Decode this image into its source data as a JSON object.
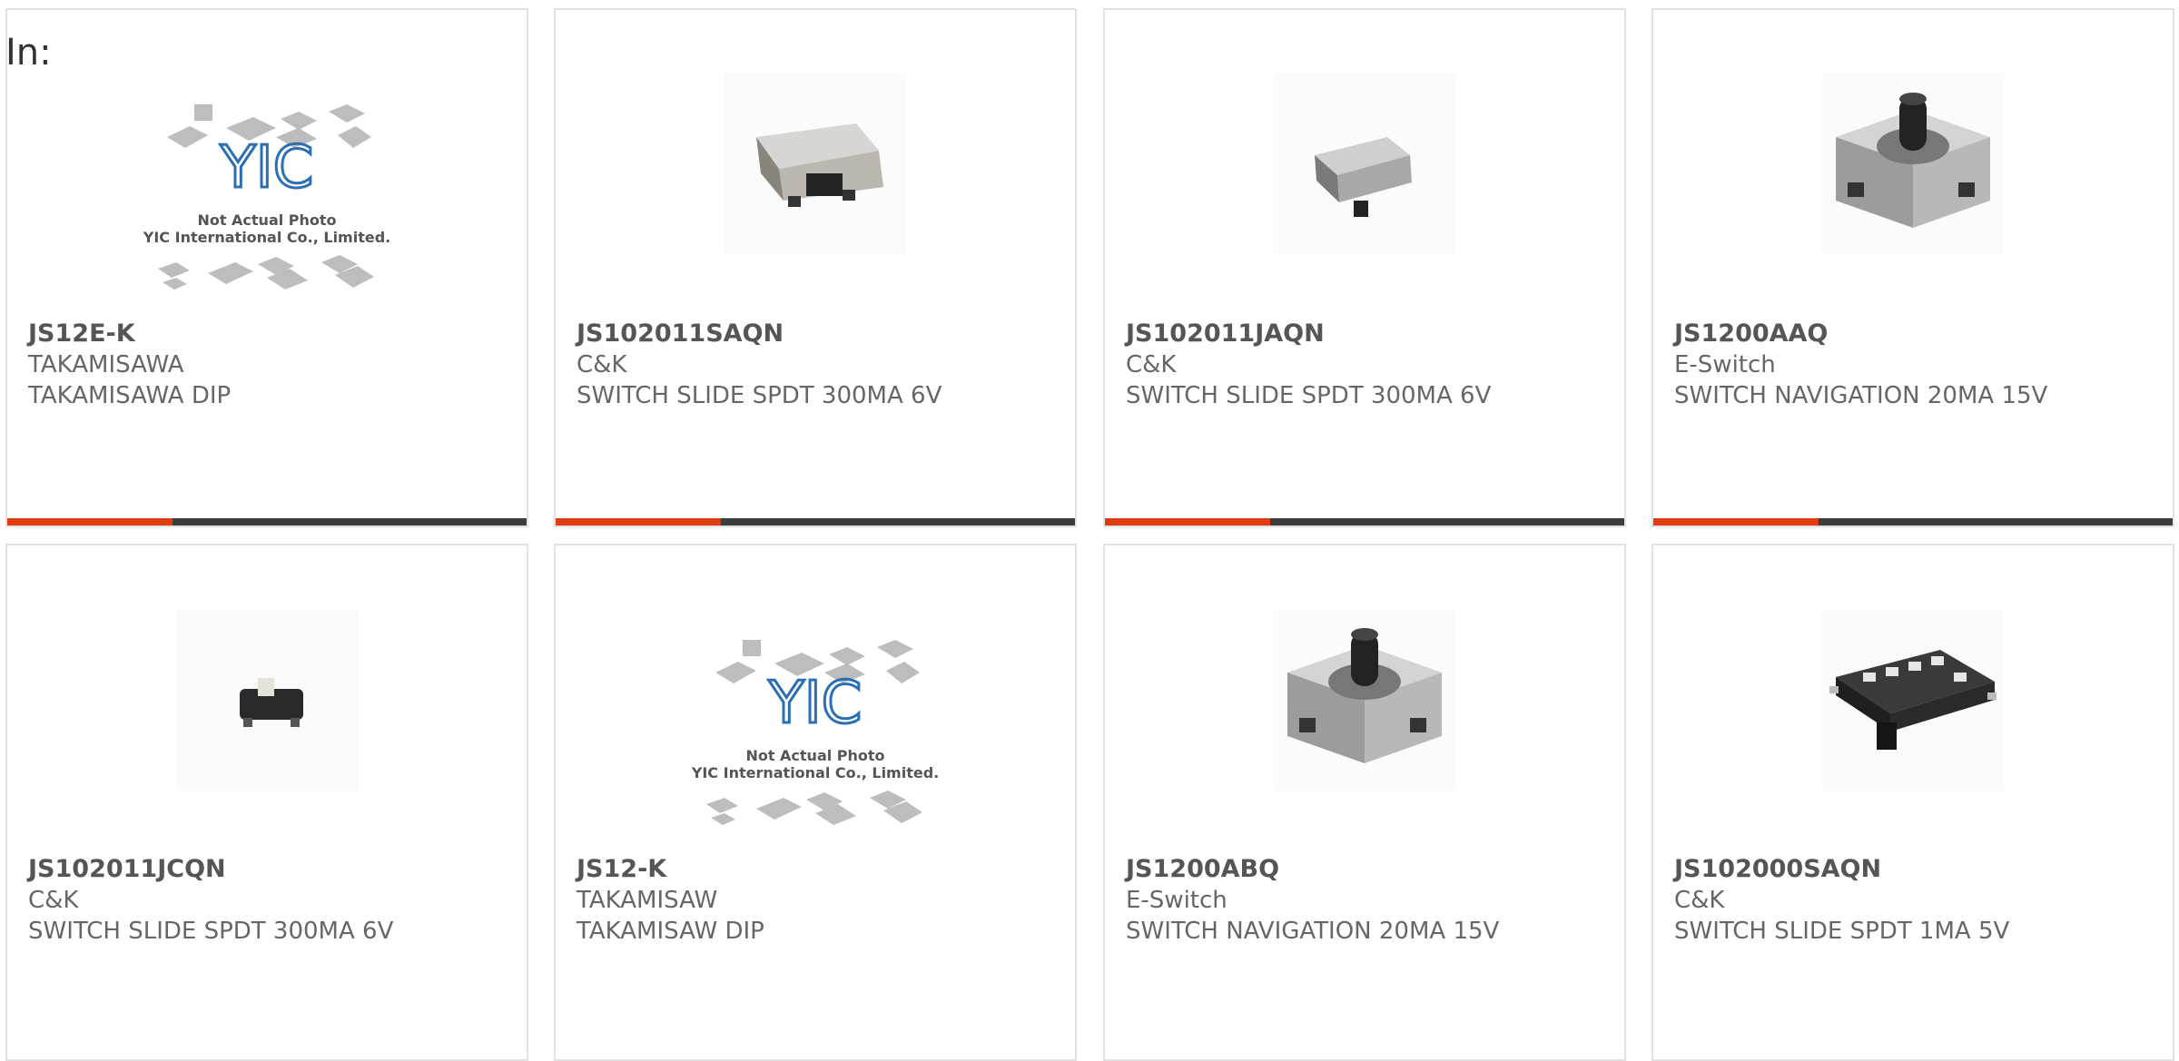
{
  "page": {
    "filter_label": "In:"
  },
  "colors": {
    "accent": "#e03c12",
    "bar": "#3c3c3c",
    "border": "#e2e2e2",
    "text": "#666666"
  },
  "products": [
    {
      "part": "JS12E-K",
      "manufacturer": "TAKAMISAWA",
      "description": "TAKAMISAWA DIP",
      "image": "yic-placeholder-logo",
      "logo_text": "YIC",
      "note_line1": "Not Actual Photo",
      "note_line2": "YIC International Co., Limited."
    },
    {
      "part": "JS102011SAQN",
      "manufacturer": "C&K",
      "description": "SWITCH SLIDE SPDT 300MA 6V",
      "image": "slide-switch-photo"
    },
    {
      "part": "JS102011JAQN",
      "manufacturer": "C&K",
      "description": "SWITCH SLIDE SPDT 300MA 6V",
      "image": "slide-switch-photo"
    },
    {
      "part": "JS1200AAQ",
      "manufacturer": "E-Switch",
      "description": "SWITCH NAVIGATION 20MA 15V",
      "image": "navigation-switch-photo"
    },
    {
      "part": "JS102011JCQN",
      "manufacturer": "C&K",
      "description": "SWITCH SLIDE SPDT 300MA 6V",
      "image": "mini-slide-switch-photo"
    },
    {
      "part": "JS12-K",
      "manufacturer": "TAKAMISAW",
      "description": "TAKAMISAW DIP",
      "image": "yic-placeholder-logo",
      "logo_text": "YIC",
      "note_line1": "Not Actual Photo",
      "note_line2": "YIC International Co., Limited."
    },
    {
      "part": "JS1200ABQ",
      "manufacturer": "E-Switch",
      "description": "SWITCH NAVIGATION 20MA 15V",
      "image": "navigation-switch-photo"
    },
    {
      "part": "JS102000SAQN",
      "manufacturer": "C&K",
      "description": "SWITCH SLIDE SPDT 1MA 5V",
      "image": "smd-slide-switch-photo"
    }
  ]
}
